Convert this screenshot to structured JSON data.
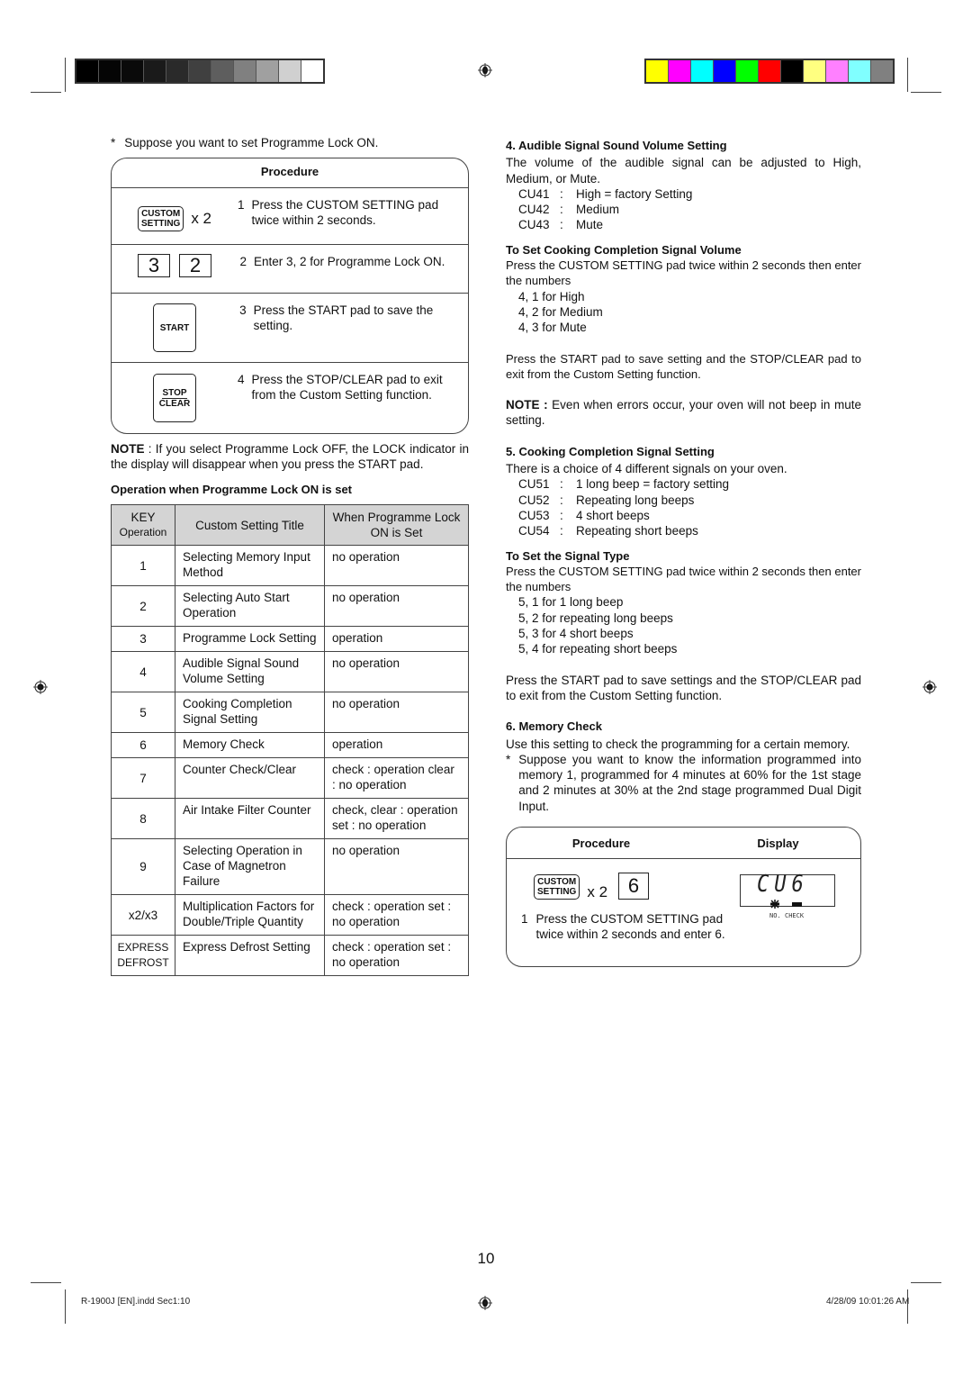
{
  "printer_marks": {
    "grayscale_bar": [
      "#000000",
      "#050505",
      "#0a0a0a",
      "#1a1a1a",
      "#2a2a2a",
      "#404040",
      "#5e5e5e",
      "#808080",
      "#a0a0a0",
      "#d0d0d0",
      "#ffffff"
    ],
    "color_bar": [
      "#ffff00",
      "#ff00ff",
      "#00ffff",
      "#0000ff",
      "#00ff00",
      "#ff0000",
      "#000000",
      "#ffff80",
      "#ff80ff",
      "#80ffff",
      "#808080"
    ],
    "registration_icon": "crosshair-target-icon"
  },
  "left": {
    "intro": "Suppose you want to set Programme Lock ON.",
    "intro_bullet": "*",
    "procedure": {
      "header": "Procedure",
      "steps": [
        {
          "no": "1",
          "text": "Press the CUSTOM SETTING pad twice within 2 seconds.",
          "pad_line1": "CUSTOM",
          "pad_line2": "SETTING",
          "times": "x 2"
        },
        {
          "no": "2",
          "text": "Enter 3, 2 for Programme Lock ON.",
          "keys": [
            "3",
            "2"
          ]
        },
        {
          "no": "3",
          "text": "Press the START pad to save the setting.",
          "pad_label": "START"
        },
        {
          "no": "4",
          "text": "Press the STOP/CLEAR pad to exit from the Custom Setting function.",
          "pad_line1": "STOP",
          "pad_line2": "CLEAR"
        }
      ]
    },
    "note_label": "NOTE",
    "note_text": " : If you select Programme Lock OFF, the LOCK indicator in the display will disappear when you press the START pad.",
    "table_title": "Operation when Programme Lock ON is set",
    "table": {
      "headers": {
        "key_line1": "KEY",
        "key_line2": "Operation",
        "title": "Custom Setting Title",
        "when": "When Programme Lock ON is Set"
      },
      "rows": [
        {
          "key": "1",
          "title": "Selecting Memory Input Method",
          "when": "no operation"
        },
        {
          "key": "2",
          "title": "Selecting Auto Start Operation",
          "when": "no operation"
        },
        {
          "key": "3",
          "title": "Programme Lock Setting",
          "when": "operation"
        },
        {
          "key": "4",
          "title": "Audible Signal Sound Volume Setting",
          "when": "no operation"
        },
        {
          "key": "5",
          "title": "Cooking Completion Signal Setting",
          "when": "no operation"
        },
        {
          "key": "6",
          "title": "Memory Check",
          "when": "operation"
        },
        {
          "key": "7",
          "title": "Counter Check/Clear",
          "when": "check : operation clear : no operation"
        },
        {
          "key": "8",
          "title": "Air Intake Filter Counter",
          "when": "check, clear : operation set : no operation"
        },
        {
          "key": "9",
          "title": "Selecting Operation in Case of Magnetron Failure",
          "when": "no operation"
        },
        {
          "key": "x2/x3",
          "title": "Multiplication Factors for Double/Triple Quantity",
          "when": "check : operation set : no operation"
        },
        {
          "key": "EXPRESS DEFROST",
          "title": "Express Defrost Setting",
          "when": "check : operation set : no operation"
        }
      ]
    }
  },
  "right": {
    "s4_heading": "4.  Audible Signal Sound Volume Setting",
    "s4_text": "The volume of the audible signal can be adjusted to High, Medium, or Mute.",
    "s4_codes": [
      {
        "code": "CU41",
        "desc": "High = factory Setting"
      },
      {
        "code": "CU42",
        "desc": "Medium"
      },
      {
        "code": "CU43",
        "desc": "Mute"
      }
    ],
    "vol_heading": "To Set Cooking Completion Signal Volume",
    "vol_text": "Press the CUSTOM SETTING pad twice within 2 seconds then enter the numbers",
    "vol_items": [
      "4, 1 for High",
      "4, 2 for Medium",
      "4, 3 for Mute"
    ],
    "vol_save": "Press the START pad to save setting and the STOP/CLEAR pad to exit from the Custom Setting function.",
    "note_label": "NOTE :",
    "note_text": " Even when errors occur, your oven will not beep in mute setting.",
    "s5_heading": "5.  Cooking Completion Signal Setting",
    "s5_text": "There is a choice of  4 different signals on your oven.",
    "s5_codes": [
      {
        "code": "CU51",
        "desc": "1 long beep = factory setting"
      },
      {
        "code": "CU52",
        "desc": "Repeating long beeps"
      },
      {
        "code": "CU53",
        "desc": "4 short beeps"
      },
      {
        "code": "CU54",
        "desc": "Repeating short beeps"
      }
    ],
    "type_heading": "To Set the Signal Type",
    "type_text": "Press the CUSTOM SETTING pad twice within 2 seconds then enter the numbers",
    "type_items": [
      "5, 1 for 1 long beep",
      "5, 2 for repeating long beeps",
      "5, 3 for 4 short beeps",
      "5, 4 for repeating short beeps"
    ],
    "type_save": "Press the START pad to save settings and the STOP/CLEAR pad to exit from the Custom Setting function.",
    "s6_heading": "6.  Memory Check",
    "s6_text": "Use this setting to check the programming for a certain memory.",
    "s6_bullet": "*",
    "s6_example": "Suppose you want to know the information programmed into memory 1, programmed for 4 minutes at 60% for the 1st stage and 2 minutes at 30% at the 2nd stage programmed Dual Digit Input.",
    "procedure": {
      "header_procedure": "Procedure",
      "header_display": "Display",
      "pad_line1": "CUSTOM",
      "pad_line2": "SETTING",
      "times": "x 2",
      "key": "6",
      "step_no": "1",
      "step_text": "Press the CUSTOM SETTING pad twice within 2 seconds and enter 6.",
      "lcd_text": "CU6",
      "lcd_ind_no": "NO.",
      "lcd_ind_check": "CHECK"
    }
  },
  "footer": {
    "page_number": "10",
    "file": "R-1900J [EN].indd   Sec1:10",
    "timestamp": "4/28/09   10:01:26 AM"
  }
}
